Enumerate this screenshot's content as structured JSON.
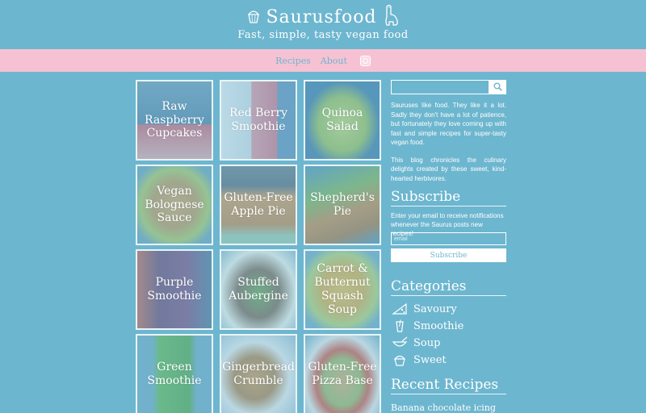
{
  "site": {
    "title": "Saurusfood",
    "tagline": "Fast, simple, tasty vegan food"
  },
  "nav": {
    "items": [
      "Recipes",
      "About"
    ],
    "instagram_icon": "instagram-icon"
  },
  "recipes": [
    {
      "title": "Raw Raspberry Cupcakes",
      "color": "#4f7fa0"
    },
    {
      "title": "Red Berry Smoothie",
      "color": "#9ab7c8"
    },
    {
      "title": "Quinoa Salad",
      "color": "#6aa0b0"
    },
    {
      "title": "Vegan Bolognese Sauce",
      "color": "#7fa898"
    },
    {
      "title": "Gluten-Free Apple Pie",
      "color": "#a9a890"
    },
    {
      "title": "Shepherd's Pie",
      "color": "#6f98a0"
    },
    {
      "title": "Purple Smoothie",
      "color": "#7c8aa0"
    },
    {
      "title": "Stuffed Aubergine",
      "color": "#8aa9a0"
    },
    {
      "title": "Carrot & Butternut Squash Soup",
      "color": "#9fb8a8"
    },
    {
      "title": "Green Smoothie",
      "color": "#7cae9c"
    },
    {
      "title": "Gingerbread Crumble",
      "color": "#a3aab0"
    },
    {
      "title": "Gluten-Free Pizza Base",
      "color": "#8aa7b0"
    }
  ],
  "sidebar": {
    "search": {
      "placeholder": "",
      "icon": "search-icon"
    },
    "about": [
      "Sauruses like food. They like it a lot. Sadly they don't have a lot of patience, but fortunately they love coming up with fast and simple recipes for super-tasty vegan food.",
      "This blog chronicles the culinary delights created by these sweet, kind-hearted herbivores."
    ],
    "subscribe": {
      "heading": "Subscribe",
      "text": "Enter your email to receive notifications whenever the Saurus posts new recipes!",
      "placeholder": "email",
      "button": "Subscribe"
    },
    "categories": {
      "heading": "Categories",
      "items": [
        {
          "label": "Savoury",
          "icon": "pizza-slice-icon"
        },
        {
          "label": "Smoothie",
          "icon": "smoothie-glass-icon"
        },
        {
          "label": "Soup",
          "icon": "soup-bowl-icon"
        },
        {
          "label": "Sweet",
          "icon": "cupcake-icon"
        }
      ]
    },
    "recent": {
      "heading": "Recent Recipes",
      "items": [
        "Banana chocolate icing"
      ]
    }
  },
  "colors": {
    "background": "#6db6cf",
    "nav_band": "#f6c2d3",
    "text": "#ffffff"
  }
}
